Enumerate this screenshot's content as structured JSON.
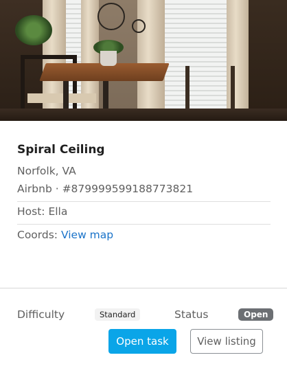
{
  "listing": {
    "title": "Spiral Ceiling",
    "location": "Norfolk, VA",
    "reference": "Airbnb · #879999599188773821",
    "host_line": "Host: Ella",
    "coords_label": "Coords:",
    "coords_link": "View map"
  },
  "footer": {
    "difficulty_label": "Difficulty",
    "difficulty_value": "Standard",
    "status_label": "Status",
    "status_value": "Open",
    "primary_button": "Open task",
    "secondary_button": "View listing"
  },
  "colors": {
    "primary": "#0aa5e8",
    "link": "#1a73c9",
    "status_badge": "#6c6f73"
  }
}
